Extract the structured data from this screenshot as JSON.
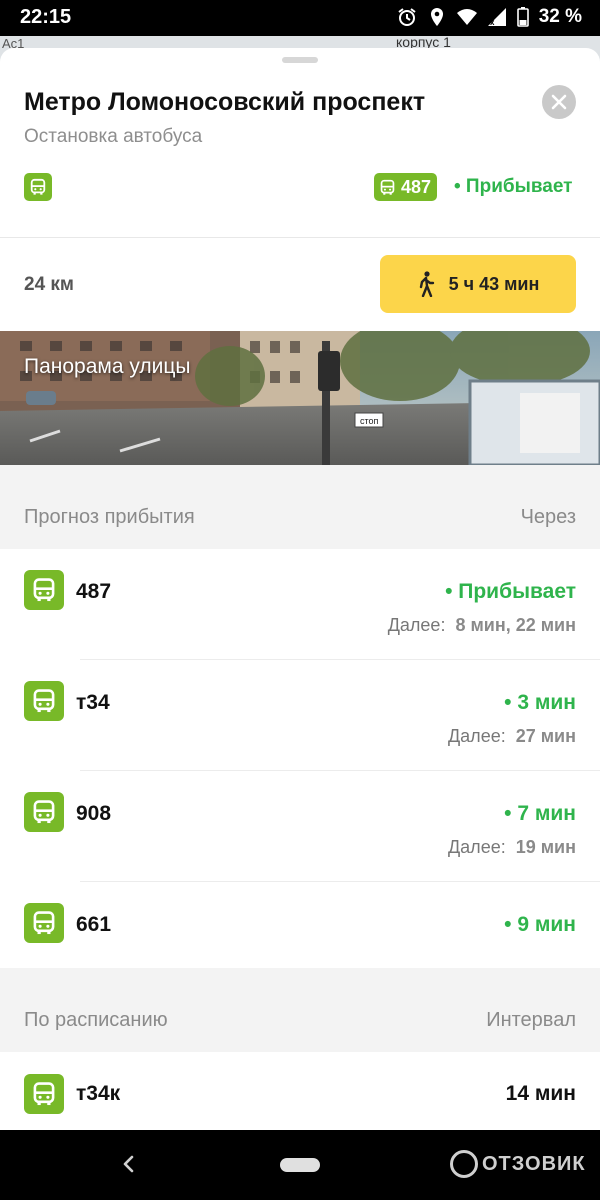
{
  "status_bar": {
    "time": "22:15",
    "battery": "32 %"
  },
  "map": {
    "label_left": "Ac1",
    "label_right": "корпус 1"
  },
  "stop": {
    "title": "Метро Ломоносовский проспект",
    "subtitle": "Остановка автобуса",
    "top_route": "487",
    "top_route_status": "• Прибывает"
  },
  "walk": {
    "distance": "24 км",
    "duration": "5 ч 43 мин"
  },
  "panorama": {
    "label": "Панорама улицы"
  },
  "forecast": {
    "header_left": "Прогноз прибытия",
    "header_right": "Через",
    "rows": [
      {
        "route": "487",
        "eta": "• Прибывает",
        "next_label": "Далее:",
        "next_value": "8 мин, 22 мин"
      },
      {
        "route": "т34",
        "eta": "• 3 мин",
        "next_label": "Далее:",
        "next_value": "27 мин"
      },
      {
        "route": "908",
        "eta": "• 7 мин",
        "next_label": "Далее:",
        "next_value": "19 мин"
      },
      {
        "route": "661",
        "eta": "• 9 мин"
      }
    ]
  },
  "schedule": {
    "header_left": "По расписанию",
    "header_right": "Интервал",
    "rows": [
      {
        "route": "т34к",
        "interval": "14 мин"
      }
    ]
  },
  "watermark": "ОТЗОВИК",
  "colors": {
    "bus_green": "#78b928",
    "eta_green": "#2fb44c",
    "walk_yellow": "#fcd54a"
  }
}
